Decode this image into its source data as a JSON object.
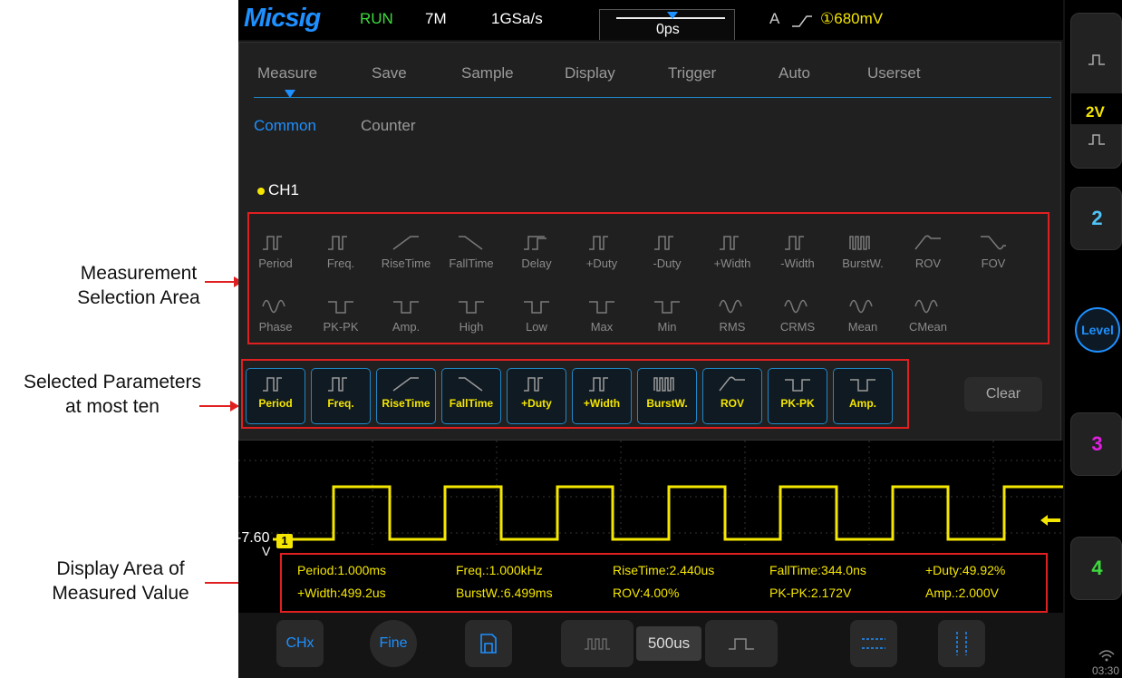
{
  "annotations": {
    "measurement_selection": [
      "Measurement",
      "Selection Area"
    ],
    "selected_parameters": [
      "Selected Parameters",
      "at most ten"
    ],
    "display_area": [
      "Display Area of",
      "Measured Value"
    ]
  },
  "topbar": {
    "logo": "Micsig",
    "status": "RUN",
    "memory_depth": "7M",
    "sample_rate": "1GSa/s",
    "trigger_position": "0ps",
    "trigger_source": "A",
    "trigger_level": "①680mV"
  },
  "right_panel": {
    "ch1_scale": "2V",
    "ch2": "2",
    "level": "Level",
    "ch3": "3",
    "ch4": "4",
    "time": "03:30"
  },
  "menu": {
    "tabs": [
      "Measure",
      "Save",
      "Sample",
      "Display",
      "Trigger",
      "Auto",
      "Userset"
    ],
    "subtabs": [
      "Common",
      "Counter"
    ],
    "channel": "CH1",
    "row1": [
      "Period",
      "Freq.",
      "RiseTime",
      "FallTime",
      "Delay",
      "+Duty",
      "-Duty",
      "+Width",
      "-Width",
      "BurstW.",
      "ROV",
      "FOV"
    ],
    "row2": [
      "Phase",
      "PK-PK",
      "Amp.",
      "High",
      "Low",
      "Max",
      "Min",
      "RMS",
      "CRMS",
      "Mean",
      "CMean"
    ],
    "selected": [
      "Period",
      "Freq.",
      "RiseTime",
      "FallTime",
      "+Duty",
      "+Width",
      "BurstW.",
      "ROV",
      "PK-PK",
      "Amp."
    ],
    "clear": "Clear"
  },
  "waveform": {
    "offset_label": "-7.60",
    "offset_unit": "V",
    "marker": "1"
  },
  "measurements": {
    "row1": [
      "Period:1.000ms",
      "Freq.:1.000kHz",
      "RiseTime:2.440us",
      "FallTime:344.0ns",
      "+Duty:49.92%"
    ],
    "row2": [
      "+Width:499.2us",
      "BurstW.:6.499ms",
      "ROV:4.00%",
      "PK-PK:2.172V",
      "Amp.:2.000V"
    ]
  },
  "bottombar": {
    "chx": "CHx",
    "fine": "Fine",
    "timebase": "500us"
  },
  "colors": {
    "accent": "#1e90ff",
    "trace": "#f5e600",
    "highlight": "#e02020"
  }
}
